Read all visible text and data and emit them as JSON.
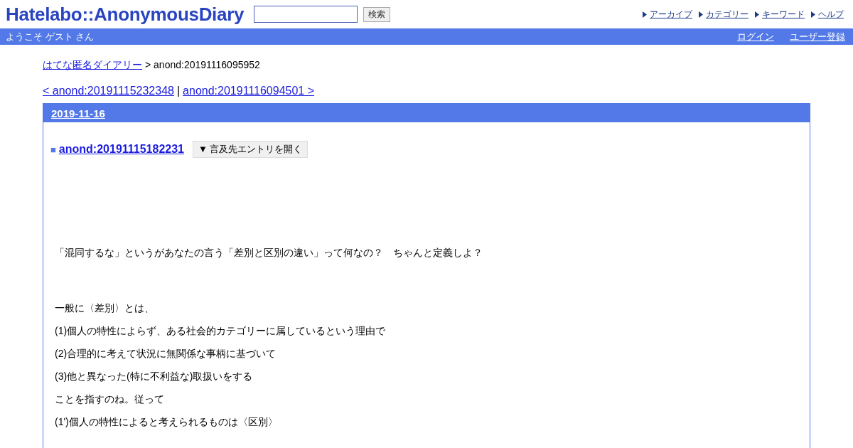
{
  "header": {
    "logo": "Hatelabo::AnonymousDiary",
    "search": {
      "button": "検索"
    },
    "nav": [
      "アーカイブ",
      "カテゴリー",
      "キーワード",
      "ヘルプ"
    ]
  },
  "userbar": {
    "welcome": "ようこそ ゲスト さん",
    "links": [
      "ログイン",
      "ユーザー登録"
    ]
  },
  "breadcrumb": {
    "link": "はてな匿名ダイアリー",
    "current": "> anond:20191116095952"
  },
  "pager": {
    "prev": "< anond:20191115232348",
    "separator": "|",
    "next": "anond:20191116094501 >"
  },
  "day": {
    "date": "2019-11-16",
    "entry": {
      "bullet": "■",
      "title": "anond:20191115182231",
      "toggle": "▼ 言及先エントリを開く",
      "paragraphs": [
        "「混同するな」というがあなたの言う「差別と区別の違い」って何なの？　ちゃんと定義しよ？",
        "一般に〈差別〉とは、",
        "(1)個人の特性によらず、ある社会的カテゴリーに属しているという理由で",
        "(2)合理的に考えて状況に無関係な事柄に基づいて",
        "(3)他と異なった(特に不利益な)取扱いをする",
        "ことを指すのね。従って",
        "(1')個人の特性によると考えられるものは〈区別〉"
      ]
    }
  }
}
